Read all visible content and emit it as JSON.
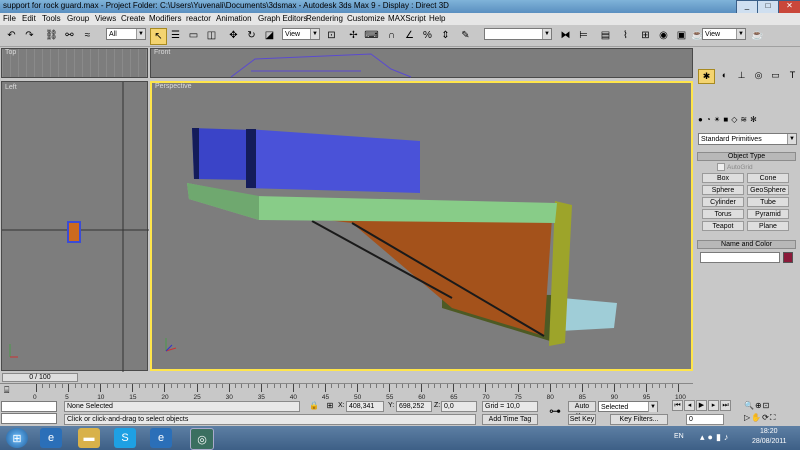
{
  "titlebar": {
    "title": "support for rock guard.max    - Project Folder: C:\\Users\\Yuvenali\\Documents\\3dsmax    - Autodesk 3ds Max 9    - Display : Direct 3D",
    "minimize": "_",
    "maximize": "□",
    "close": "✕"
  },
  "menu": [
    "File",
    "Edit",
    "Tools",
    "Group",
    "Views",
    "Create",
    "Modifiers",
    "reactor",
    "Animation",
    "Graph Editors",
    "Rendering",
    "Customize",
    "MAXScript",
    "Help"
  ],
  "toolbar": {
    "selection_filter": "All",
    "ref_coord": "View",
    "named_selection": "",
    "view_combo": "View"
  },
  "viewports": {
    "top_label": "Top",
    "front_label": "Front",
    "left_label": "Left",
    "perspective_label": "Perspective"
  },
  "command_panel": {
    "category": "Standard Primitives",
    "object_type_header": "Object Type",
    "autogrid": "AutoGrid",
    "buttons": [
      "Box",
      "Cone",
      "Sphere",
      "GeoSphere",
      "Cylinder",
      "Tube",
      "Torus",
      "Pyramid",
      "Teapot",
      "Plane"
    ],
    "name_color_header": "Name and Color",
    "object_color": "#8b1a3a"
  },
  "timeline": {
    "frame_counter": "0 / 100",
    "ticks": [
      "0",
      "5",
      "10",
      "15",
      "20",
      "25",
      "30",
      "35",
      "40",
      "45",
      "50",
      "55",
      "60",
      "65",
      "70",
      "75",
      "80",
      "85",
      "90",
      "95",
      "100"
    ]
  },
  "status": {
    "selection": "None Selected",
    "prompt": "Click or click-and-drag to select objects",
    "x_label": "X:",
    "x_value": "408,341",
    "y_label": "Y:",
    "y_value": "698,252",
    "z_label": "Z:",
    "z_value": "0,0",
    "grid": "Grid = 10,0",
    "add_time_tag": "Add Time Tag",
    "auto_key": "Auto Key",
    "auto_key_mode": "Selected",
    "set_key": "Set Key",
    "key_filters": "Key Filters...",
    "frame": "0"
  },
  "taskbar": {
    "language": "EN",
    "time": "18:20",
    "date": "28/08/2011"
  }
}
